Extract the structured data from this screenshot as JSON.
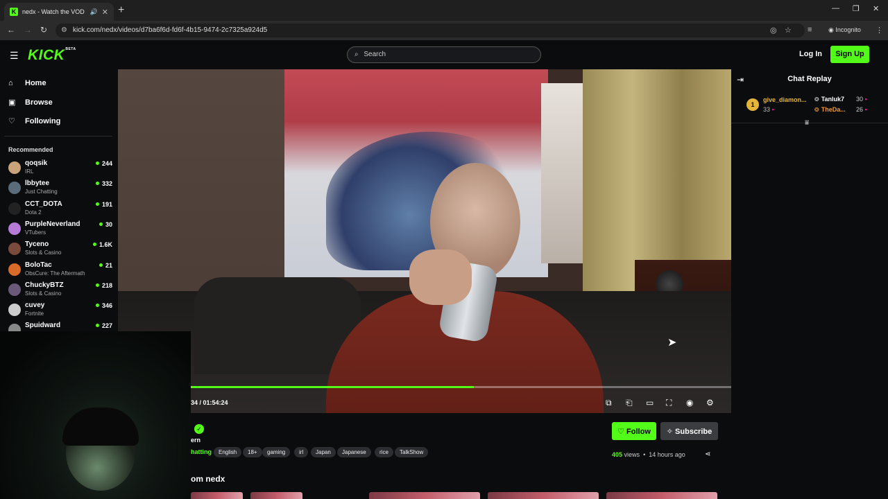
{
  "browser": {
    "tab_title": "nedx - Watch the VOD on",
    "url": "kick.com/nedx/videos/d7ba6f6d-fd6f-4b15-9474-2c7325a924d5",
    "incognito_label": "Incognito"
  },
  "header": {
    "logo": "KICK",
    "logo_badge": "BETA",
    "search_placeholder": "Search",
    "login_label": "Log In",
    "signup_label": "Sign Up"
  },
  "sidebar": {
    "nav": [
      {
        "label": "Home",
        "icon": "home-icon"
      },
      {
        "label": "Browse",
        "icon": "browse-icon"
      },
      {
        "label": "Following",
        "icon": "heart-icon"
      }
    ],
    "recommended_title": "Recommended",
    "recommended": [
      {
        "name": "qoqsik",
        "category": "IRL",
        "viewers": "244",
        "color": "#c9a37a"
      },
      {
        "name": "lbbytee",
        "category": "Just Chatting",
        "viewers": "332",
        "color": "#5a6b7a"
      },
      {
        "name": "CCT_DOTA",
        "category": "Dota 2",
        "viewers": "191",
        "color": "#222222"
      },
      {
        "name": "PurpleNeverland",
        "category": "VTubers",
        "viewers": "30",
        "color": "#b67ad8"
      },
      {
        "name": "Tyceno",
        "category": "Slots & Casino",
        "viewers": "1.6K",
        "color": "#7a4a3a"
      },
      {
        "name": "BoloTac",
        "category": "ObsCure: The Aftermath",
        "viewers": "21",
        "color": "#d86a2a"
      },
      {
        "name": "ChuckyBTZ",
        "category": "Slots & Casino",
        "viewers": "218",
        "color": "#6a5a7a"
      },
      {
        "name": "cuvey",
        "category": "Fortnite",
        "viewers": "346",
        "color": "#cccccc"
      },
      {
        "name": "Spuidward",
        "category": "",
        "viewers": "227",
        "color": "#888888"
      }
    ]
  },
  "player": {
    "timecode": "34 / 01:54:24",
    "progress": 0.58
  },
  "info": {
    "subline": "ern",
    "category": "hatting",
    "tags": [
      "English",
      "18+",
      "gaming",
      "irl",
      "Japan",
      "Japanese",
      "rice",
      "TalkShow"
    ],
    "follow_label": "Follow",
    "subscribe_label": "Subscribe",
    "views_count": "405",
    "views_word": "views",
    "age": "14 hours ago",
    "more_from": "om nedx"
  },
  "chat": {
    "title": "Chat Replay",
    "top_gifter": {
      "rank": "1",
      "name": "give_diamon...",
      "count": "33"
    },
    "gifters": [
      {
        "name": "Tanluk7",
        "count": "30",
        "color": "#ffffff"
      },
      {
        "name": "TheDa...",
        "count": "26",
        "color": "#f09a3a"
      }
    ]
  }
}
